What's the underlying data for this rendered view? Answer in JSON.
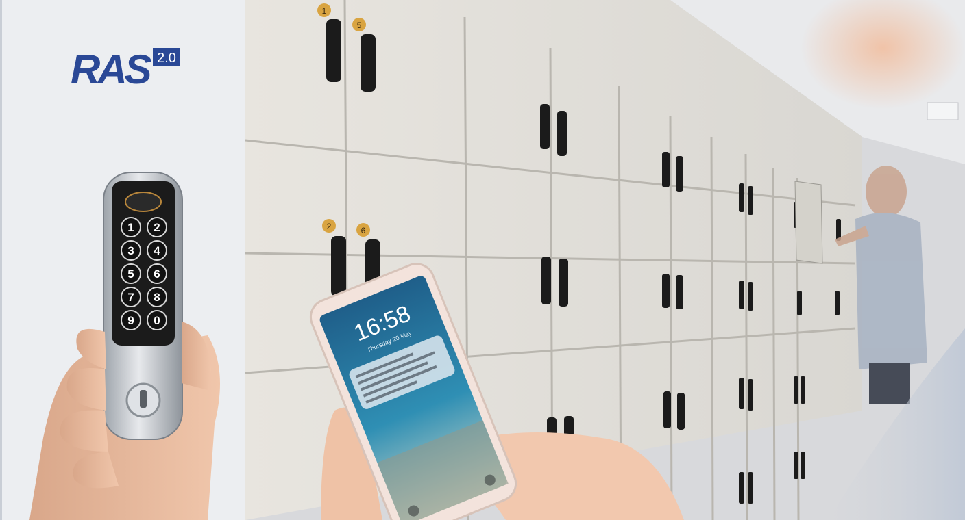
{
  "logo": {
    "text": "RAS",
    "version": "2.0",
    "color": "#2a4896"
  },
  "keypad": {
    "keys": [
      "1",
      "2",
      "3",
      "4",
      "5",
      "6",
      "7",
      "8",
      "9",
      "0"
    ]
  },
  "phone": {
    "time": "16:58",
    "date": "Thursday 20 May"
  },
  "locker_numbers": [
    "1",
    "5",
    "2",
    "6"
  ],
  "colors": {
    "wall": "#e6e3dd",
    "panel": "#eceef1",
    "brand": "#2a4896",
    "lock_black": "#1b1b1b",
    "badge_gold": "#d9a441",
    "sea": "#2f8fb4"
  }
}
